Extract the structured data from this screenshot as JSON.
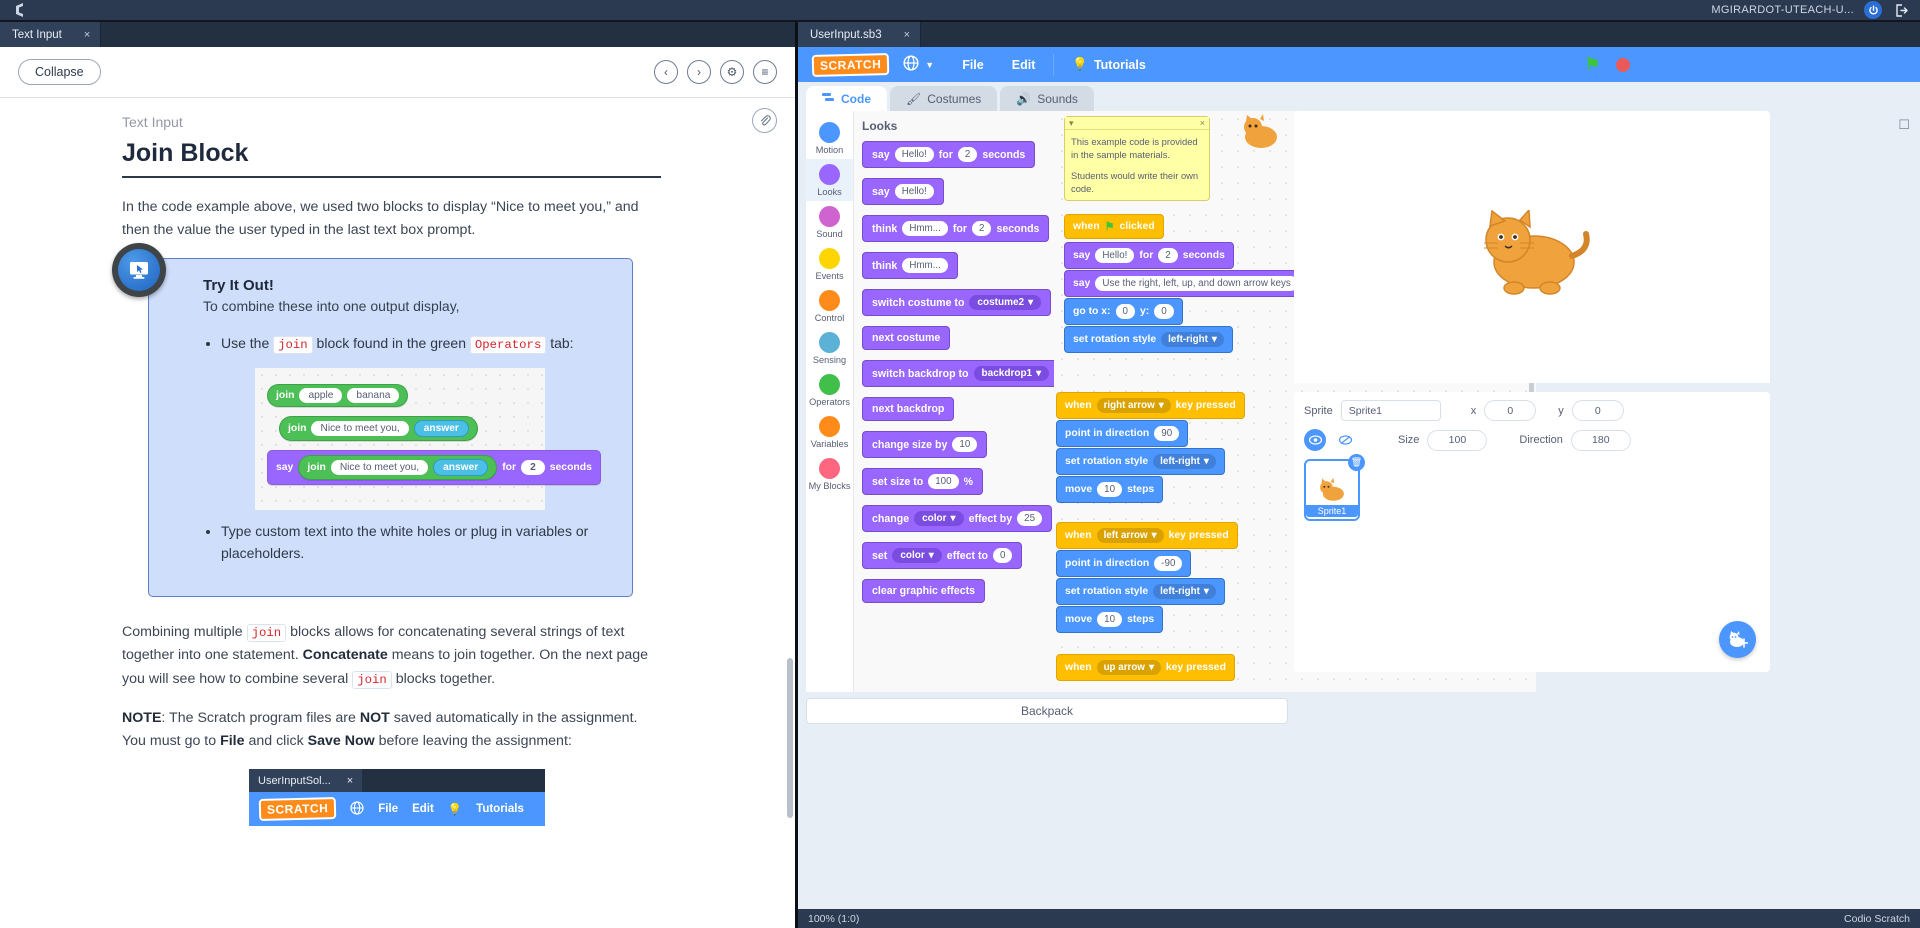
{
  "topbar": {
    "user": "MGIRARDOT-UTEACH-U...",
    "power_icon": "power-icon",
    "logout_icon": "logout-icon",
    "logo_icon": "codio-logo-icon"
  },
  "left": {
    "tab": {
      "label": "Text Input",
      "close": "×"
    },
    "collapse_label": "Collapse",
    "nav": {
      "prev": "‹",
      "next": "›",
      "gear": "⚙",
      "list": "≡"
    },
    "attach_icon": "paperclip-icon",
    "kicker": "Text Input",
    "title": "Join Block",
    "p1": "In the code example above, we used two blocks to display “Nice to meet you,” and then the value the user typed in the last text box prompt.",
    "callout": {
      "heading": "Try It Out!",
      "sub": "To combine these into one output display,",
      "bullet1_a": "Use the ",
      "bullet1_code1": "join",
      "bullet1_b": " block found in the green ",
      "bullet1_code2": "Operators",
      "bullet1_c": " tab:",
      "bullet2": "Type custom text into the white holes or plug in variables or placeholders.",
      "blocks": {
        "row1": {
          "op": "join",
          "a": "apple",
          "b": "banana"
        },
        "row2": {
          "op": "join",
          "a": "Nice to meet you,",
          "b": "answer"
        },
        "row3": {
          "say": "say",
          "op": "join",
          "a": "Nice to meet you,",
          "b": "answer",
          "for": "for",
          "num": "2",
          "seconds": "seconds"
        }
      }
    },
    "p2_a": "Combining multiple ",
    "p2_code1": "join",
    "p2_b": " blocks allows for concatenating several strings of text together into one statement. ",
    "p2_bold": "Concatenate",
    "p2_c": " means to join together. On the next page you will see how to combine several ",
    "p2_code2": "join",
    "p2_d": " blocks together.",
    "p3_note": "NOTE",
    "p3_a": ": The Scratch program files are ",
    "p3_not": "NOT",
    "p3_b": " saved automatically in the assignment. You must go to ",
    "p3_file": "File",
    "p3_c": " and click ",
    "p3_save": "Save Now",
    "p3_d": " before leaving the assignment:",
    "embed": {
      "tab": "UserInputSol...",
      "tab_close": "×",
      "wordmark": "SCRATCH",
      "globe": "globe-icon",
      "file": "File",
      "edit": "Edit",
      "tutorials": "Tutorials"
    }
  },
  "right": {
    "tab": {
      "label": "UserInput.sb3",
      "close": "×"
    },
    "menu": {
      "wordmark": "SCRATCH",
      "globe": "globe-icon",
      "file": "File",
      "edit": "Edit",
      "tutorials": "Tutorials",
      "green_flag": "green-flag-icon",
      "stop": "stop-icon",
      "fullscreen": "fullscreen-icon"
    },
    "tabs": [
      {
        "label": "Code",
        "icon": "code-icon",
        "active": true
      },
      {
        "label": "Costumes",
        "icon": "brush-icon",
        "active": false
      },
      {
        "label": "Sounds",
        "icon": "speaker-icon",
        "active": false
      }
    ],
    "categories": [
      {
        "label": "Motion",
        "color": "#4c97ff"
      },
      {
        "label": "Looks",
        "color": "#9966ff"
      },
      {
        "label": "Sound",
        "color": "#cf63cf"
      },
      {
        "label": "Events",
        "color": "#ffd500"
      },
      {
        "label": "Control",
        "color": "#ff8c1a"
      },
      {
        "label": "Sensing",
        "color": "#5cb1d6"
      },
      {
        "label": "Operators",
        "color": "#40bf4a"
      },
      {
        "label": "Variables",
        "color": "#ff8c1a"
      },
      {
        "label": "My Blocks",
        "color": "#ff6680"
      }
    ],
    "palette_title": "Looks",
    "palette_blocks": [
      {
        "parts": [
          "say"
        ],
        "oval": "Hello!",
        "mid": "for",
        "num": "2",
        "tail": "seconds"
      },
      {
        "parts": [
          "say"
        ],
        "oval": "Hello!"
      },
      {
        "parts": [
          "think"
        ],
        "oval": "Hmm...",
        "mid": "for",
        "num": "2",
        "tail": "seconds"
      },
      {
        "parts": [
          "think"
        ],
        "oval": "Hmm..."
      },
      {
        "parts": [
          "switch costume to"
        ],
        "drop": "costume2"
      },
      {
        "parts": [
          "next costume"
        ]
      },
      {
        "parts": [
          "switch backdrop to"
        ],
        "drop": "backdrop1"
      },
      {
        "parts": [
          "next backdrop"
        ]
      },
      {
        "parts": [
          "change size by"
        ],
        "num": "10"
      },
      {
        "parts": [
          "set size to"
        ],
        "num": "100",
        "tail": "%"
      },
      {
        "parts": [
          "change"
        ],
        "drop": "color",
        "mid": "effect by",
        "num": "25"
      },
      {
        "parts": [
          "set"
        ],
        "drop": "color",
        "mid": "effect to",
        "num": "0"
      },
      {
        "parts": [
          "clear graphic effects"
        ]
      }
    ],
    "comment": {
      "line1": "This example code is provided in the sample materials.",
      "line2": "Students would write their own code.",
      "close": "×",
      "collapse": "▾"
    },
    "script1": [
      {
        "type": "event",
        "text": "when",
        "flag": "green-flag-icon",
        "tail": "clicked"
      },
      {
        "type": "looks",
        "text": "say",
        "oval": "Hello!",
        "mid": "for",
        "num": "2",
        "tail": "seconds"
      },
      {
        "type": "looks",
        "text": "say",
        "oval": "Use the right, left, up, and down arrow keys"
      },
      {
        "type": "motion",
        "text": "go to x:",
        "num": "0",
        "mid": "y:",
        "num2": "0"
      },
      {
        "type": "motion",
        "text": "set rotation style",
        "drop": "left-right"
      }
    ],
    "script2": [
      {
        "type": "event",
        "text": "when",
        "drop": "right arrow",
        "tail": "key pressed"
      },
      {
        "type": "motion",
        "text": "point in direction",
        "num": "90"
      },
      {
        "type": "motion",
        "text": "set rotation style",
        "drop": "left-right"
      },
      {
        "type": "motion",
        "text": "move",
        "num": "10",
        "tail": "steps"
      }
    ],
    "script3": [
      {
        "type": "event",
        "text": "when",
        "drop": "left arrow",
        "tail": "key pressed"
      },
      {
        "type": "motion",
        "text": "point in direction",
        "num": "-90"
      },
      {
        "type": "motion",
        "text": "set rotation style",
        "drop": "left-right"
      },
      {
        "type": "motion",
        "text": "move",
        "num": "10",
        "tail": "steps"
      }
    ],
    "script4": [
      {
        "type": "event",
        "text": "when",
        "drop": "up arrow",
        "tail": "key pressed"
      }
    ],
    "zoom_controls": {
      "in": "+",
      "out": "−",
      "reset": "="
    },
    "backpack": "Backpack",
    "sprite": {
      "label": "Sprite",
      "name": "Sprite1",
      "x_label": "x",
      "x_value": "0",
      "y_label": "y",
      "y_value": "0",
      "size_label": "Size",
      "size_value": "100",
      "direction_label": "Direction",
      "direction_value": "180",
      "show_icon": "eye-icon",
      "hide_icon": "eye-slash-icon",
      "tile_name": "Sprite1",
      "delete_icon": "trash-icon",
      "add_icon": "add-sprite-icon"
    },
    "status": {
      "left": "100%  (1:0)",
      "right": "Codio Scratch"
    }
  }
}
